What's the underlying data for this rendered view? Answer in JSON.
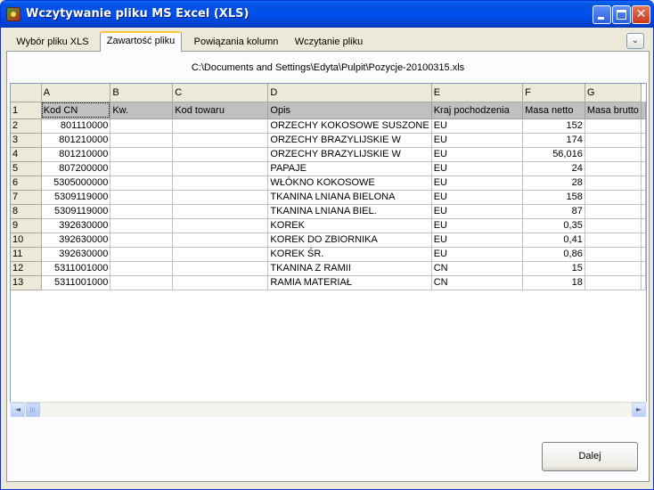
{
  "window": {
    "title": "Wczytywanie pliku MS Excel (XLS)",
    "close_glyph": "✕"
  },
  "tabs": [
    {
      "label": "Wybór pliku XLS",
      "active": false
    },
    {
      "label": "Zawartość pliku",
      "active": true
    },
    {
      "label": "Powiązania kolumn",
      "active": false
    },
    {
      "label": "Wczytanie pliku",
      "active": false
    }
  ],
  "tab_collapse_glyph": "⌄",
  "file_path": "C:\\Documents and Settings\\Edyta\\Pulpit\\Pozycje-20100315.xls",
  "grid": {
    "columns": [
      "A",
      "B",
      "C",
      "D",
      "E",
      "F",
      "G"
    ],
    "rows": [
      {
        "n": "1",
        "cells": [
          "Kod CN",
          "Kw.",
          "Kod towaru",
          "Opis",
          "Kraj pochodzenia",
          "Masa netto",
          "Masa brutto"
        ]
      },
      {
        "n": "2",
        "cells": [
          "801110000",
          "",
          "",
          "ORZECHY KOKOSOWE SUSZONE",
          "EU",
          "152",
          ""
        ]
      },
      {
        "n": "3",
        "cells": [
          "801210000",
          "",
          "",
          "ORZECHY BRAZYLIJSKIE W",
          "EU",
          "174",
          ""
        ]
      },
      {
        "n": "4",
        "cells": [
          "801210000",
          "",
          "",
          "ORZECHY BRAZYLIJSKIE W",
          "EU",
          "56,016",
          ""
        ]
      },
      {
        "n": "5",
        "cells": [
          "807200000",
          "",
          "",
          "PAPAJE",
          "EU",
          "24",
          ""
        ]
      },
      {
        "n": "6",
        "cells": [
          "5305000000",
          "",
          "",
          "WŁÓKNO KOKOSOWE",
          "EU",
          "28",
          ""
        ]
      },
      {
        "n": "7",
        "cells": [
          "5309119000",
          "",
          "",
          "TKANINA LNIANA BIELONA",
          "EU",
          "158",
          ""
        ]
      },
      {
        "n": "8",
        "cells": [
          "5309119000",
          "",
          "",
          "TKANINA LNIANA BIEL.",
          "EU",
          "87",
          ""
        ]
      },
      {
        "n": "9",
        "cells": [
          "392630000",
          "",
          "",
          "KOREK",
          "EU",
          "0,35",
          ""
        ]
      },
      {
        "n": "10",
        "cells": [
          "392630000",
          "",
          "",
          "KOREK DO ZBIORNIKA",
          "EU",
          "0,41",
          ""
        ]
      },
      {
        "n": "11",
        "cells": [
          "392630000",
          "",
          "",
          "KOREK ŚR.",
          "EU",
          "0,86",
          ""
        ]
      },
      {
        "n": "12",
        "cells": [
          "5311001000",
          "",
          "",
          "TKANINA Z RAMII",
          "CN",
          "15",
          ""
        ]
      },
      {
        "n": "13",
        "cells": [
          "5311001000",
          "",
          "",
          "RAMIA MATERIAŁ",
          "CN",
          "18",
          ""
        ]
      }
    ]
  },
  "scrollbar": {
    "left_glyph": "◄",
    "right_glyph": "►"
  },
  "buttons": {
    "next_label": "Dalej"
  },
  "colors": {
    "titlebar": "#0050ee",
    "tab_highlight": "#ffc83c",
    "header_row_bg": "#c0c0c0"
  }
}
